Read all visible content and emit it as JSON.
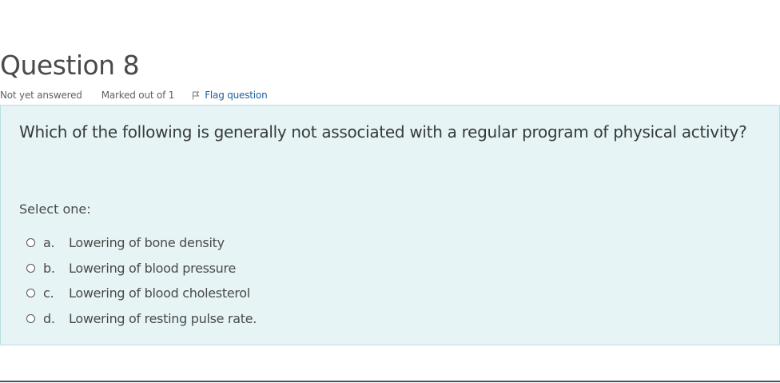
{
  "question": {
    "title": "Question 8",
    "state": "Not yet answered",
    "grade": "Marked out of 1",
    "flag_label": "Flag question",
    "text": "Which of the following is generally not associated with a regular program of physical activity?",
    "prompt": "Select one:",
    "options": [
      {
        "letter": "a.",
        "text": "Lowering of bone density"
      },
      {
        "letter": "b.",
        "text": "Lowering of blood pressure"
      },
      {
        "letter": "c.",
        "text": "Lowering of blood cholesterol"
      },
      {
        "letter": "d.",
        "text": "Lowering of resting pulse rate."
      }
    ]
  },
  "icons": {
    "flag": "flag-icon",
    "radio": "radio-unchecked-icon"
  },
  "colors": {
    "panel_background": "#e6f4f5",
    "panel_border": "#b9dfe3",
    "link": "#1f5f9e",
    "bottom_rule": "#355b66"
  }
}
